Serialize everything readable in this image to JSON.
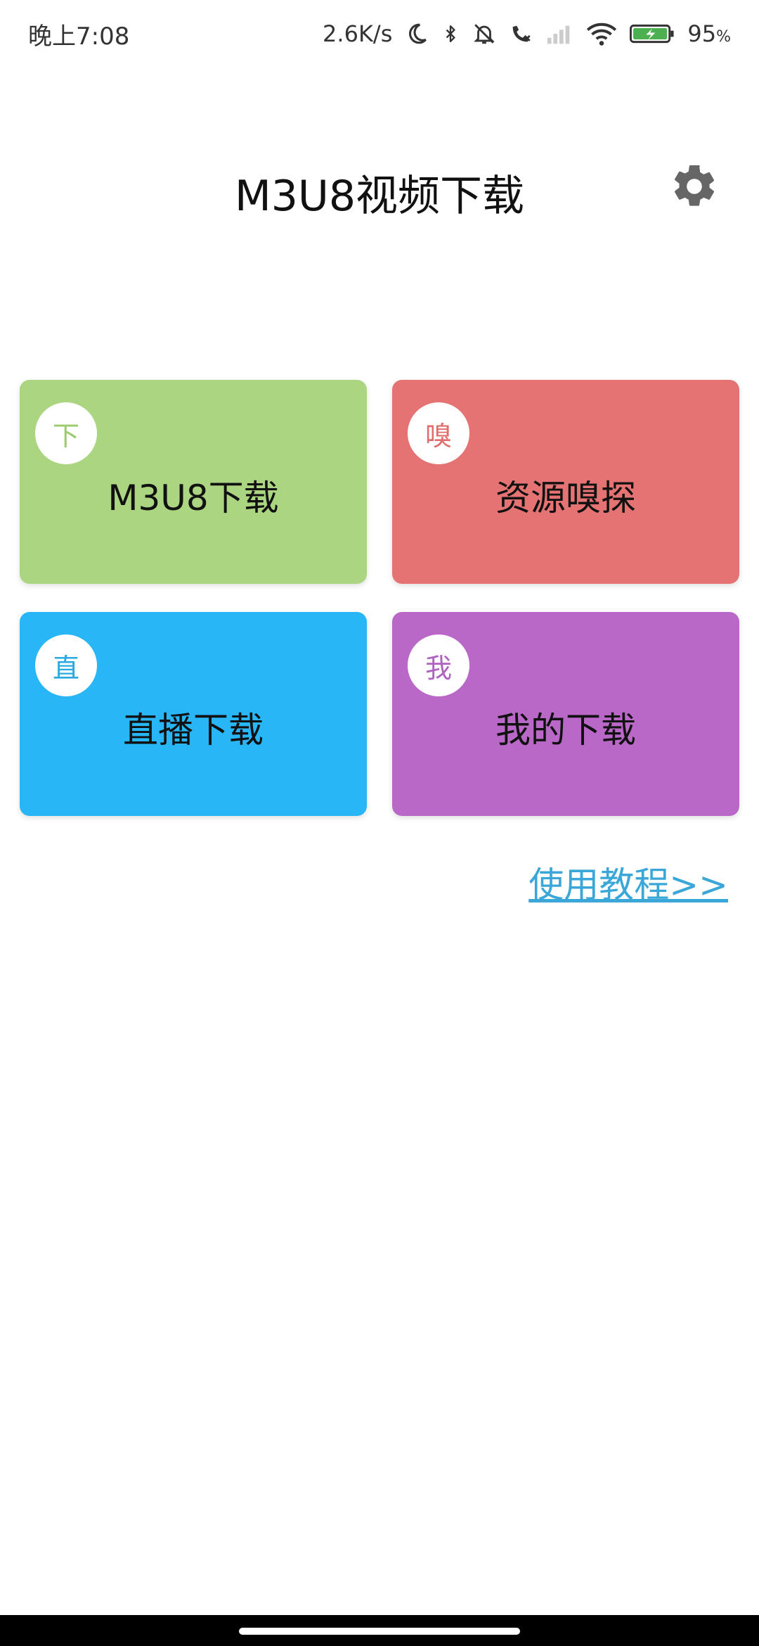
{
  "status_bar": {
    "time": "晚上7:08",
    "net_speed": "2.6K/s",
    "battery": "95",
    "battery_unit": "%",
    "icons": [
      "moon-icon",
      "bluetooth-icon",
      "bell-off-icon",
      "call-icon",
      "signal-icon",
      "wifi-icon",
      "battery-icon"
    ]
  },
  "header": {
    "title": "M3U8视频下载",
    "settings_icon": "gear-icon"
  },
  "cards": [
    {
      "badge": "下",
      "label": "M3U8下载",
      "color": "#acd581",
      "badge_color": "#9acb6d"
    },
    {
      "badge": "嗅",
      "label": "资源嗅探",
      "color": "#e57373",
      "badge_color": "#e06d6d"
    },
    {
      "badge": "直",
      "label": "直播下载",
      "color": "#29b6f6",
      "badge_color": "#29a9e3"
    },
    {
      "badge": "我",
      "label": "我的下载",
      "color": "#ba68c8",
      "badge_color": "#b062c0"
    }
  ],
  "tutorial": {
    "label": "使用教程>>"
  }
}
